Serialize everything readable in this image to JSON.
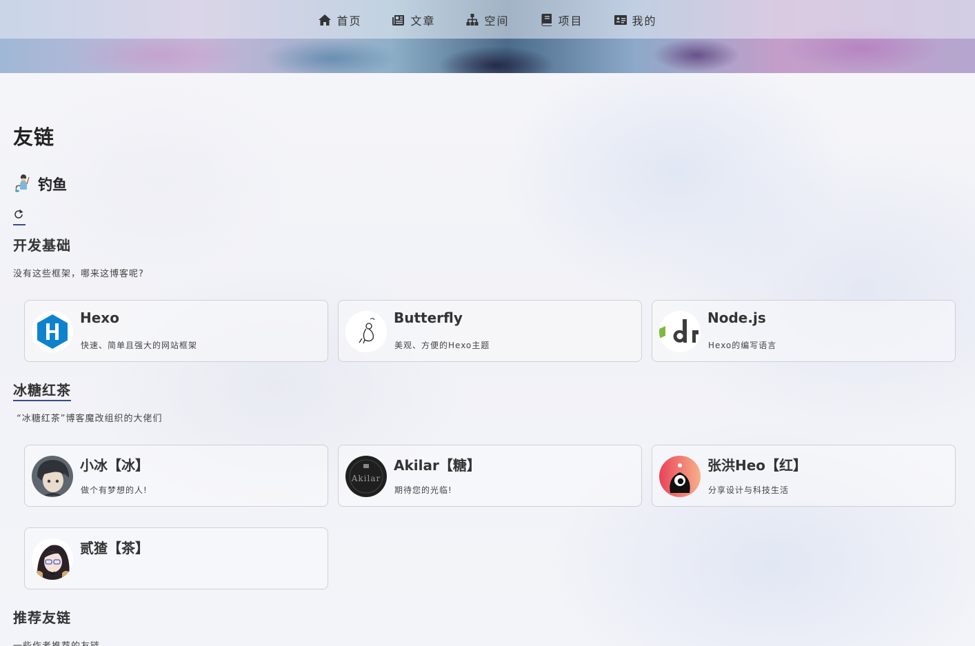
{
  "nav": {
    "items": [
      {
        "label": "首页",
        "icon": "home-icon"
      },
      {
        "label": "文章",
        "icon": "newspaper-icon"
      },
      {
        "label": "空间",
        "icon": "sitemap-icon"
      },
      {
        "label": "项目",
        "icon": "book-icon"
      },
      {
        "label": "我的",
        "icon": "id-card-icon"
      }
    ]
  },
  "page": {
    "title": "友链",
    "fishing_label": "钓鱼"
  },
  "sections": [
    {
      "title": "开发基础",
      "desc": "没有这些框架，哪来这博客呢?",
      "links": [
        {
          "name": "Hexo",
          "desc": "快速、简单且强大的网站框架",
          "avatar": "hexo-logo"
        },
        {
          "name": "Butterfly",
          "desc": "美观、方便的Hexo主题",
          "avatar": "butterfly-avatar"
        },
        {
          "name": "Node.js",
          "desc": "Hexo的编写语言",
          "avatar": "nodejs-logo"
        }
      ]
    },
    {
      "title": "冰糖红茶",
      "desc": "“冰糖红茶”博客魔改组织的大佬们",
      "links": [
        {
          "name": "小冰【冰】",
          "desc": "做个有梦想的人!",
          "avatar": "xiaobing-avatar"
        },
        {
          "name": "Akilar【糖】",
          "desc": "期待您的光临!",
          "avatar": "akilar-avatar"
        },
        {
          "name": "张洪Heo【红】",
          "desc": "分享设计与科技生活",
          "avatar": "heo-avatar"
        },
        {
          "name": "贰猹【茶】",
          "desc": "",
          "avatar": "ercha-avatar"
        }
      ]
    },
    {
      "title": "推荐友链",
      "desc": "一些作者推荐的友链"
    }
  ],
  "colors": {
    "accent_underline": "#3b4a8c",
    "hexo_blue": "#0e83cd",
    "node_green": "#7cba3d"
  }
}
